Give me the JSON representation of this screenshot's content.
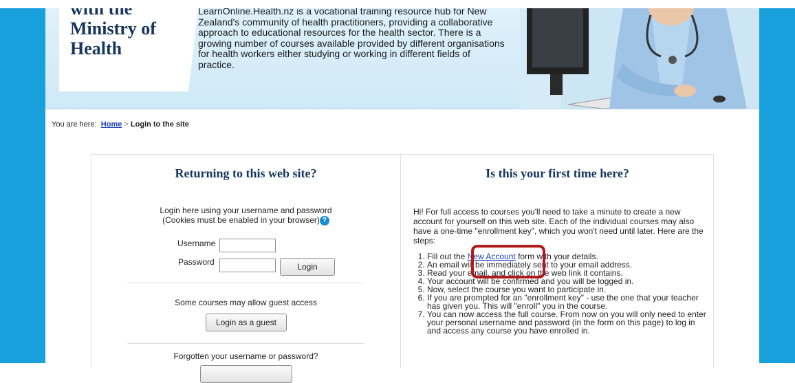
{
  "banner": {
    "brand_lines": "with the\nMinistry of\nHealth",
    "intro": "LearnOnline.Health.nz is a vocational training resource hub for New Zealand's community of health practitioners, providing a collaborative approach to educational resources for the health sector. There is a growing number of courses available provided by different organisations for health workers either studying or working in different fields of practice."
  },
  "breadcrumb": {
    "prefix": "You are here:",
    "home": "Home",
    "separator": ">",
    "current": "Login to the site"
  },
  "login": {
    "heading": "Returning to this web site?",
    "instructions_line1": "Login here using your username and password",
    "instructions_line2": "(Cookies must be enabled in your browser)",
    "username_label": "Username",
    "username_value": "",
    "password_label": "Password",
    "password_value": "",
    "login_button": "Login",
    "guest_text": "Some courses may allow guest access",
    "guest_button": "Login as a guest",
    "forgot_text": "Forgotten your username or password?"
  },
  "signup": {
    "heading": "Is this your first time here?",
    "intro": "Hi! For full access to courses you'll need to take a minute to create a new account for yourself on this web site. Each of the individual courses may also have a one-time \"enrollment key\", which you won't need until later. Here are the steps:",
    "step1_before": "Fill out the ",
    "step1_link": "New Account",
    "step1_after": " form with your details.",
    "steps": [
      "An email will be immediately sent to your email address.",
      "Read your email, and click on the web link it contains.",
      "Your account will be confirmed and you will be logged in.",
      "Now, select the course you want to participate in.",
      "If you are prompted for an \"enrollment key\" - use the one that your teacher has given you. This will \"enroll\" you in the course.",
      "You can now access the full course. From now on you will only need to enter your personal username and password (in the form on this page) to log in and access any course you have enrolled in."
    ]
  },
  "colors": {
    "side_bars": "#18a0dc",
    "heading": "#17365d",
    "link": "#1a3fbd",
    "highlight": "#b21a1f"
  }
}
